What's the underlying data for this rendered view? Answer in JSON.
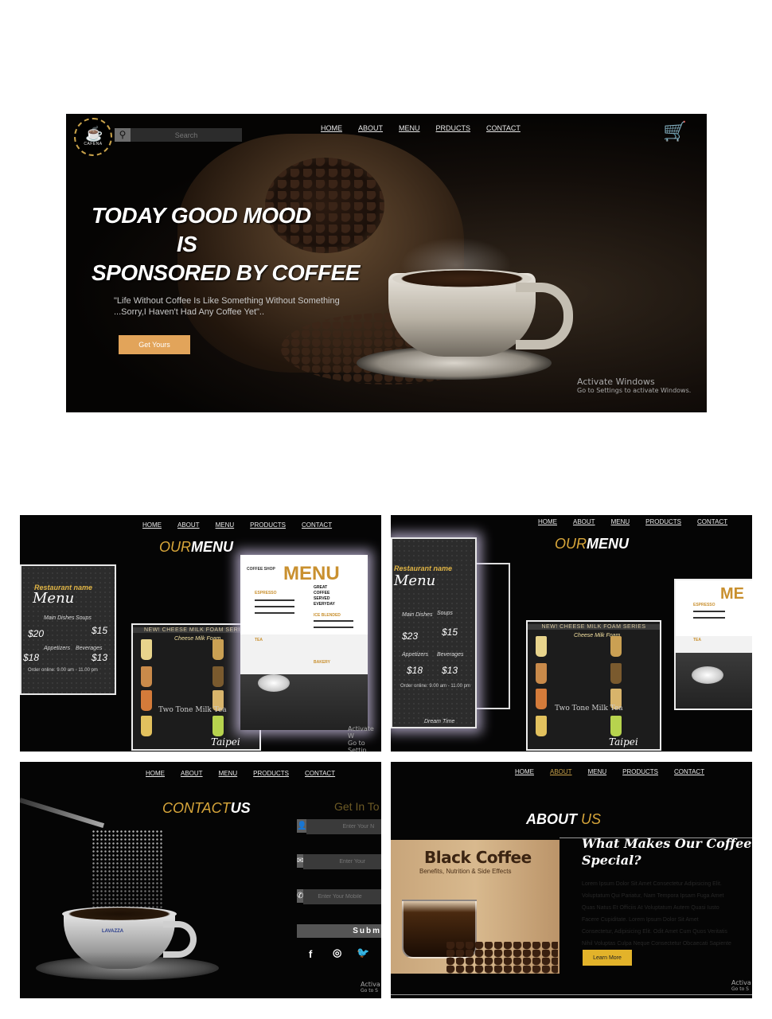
{
  "hero": {
    "nav": [
      "HOME",
      "ABOUT",
      "MENU",
      "PRDUCTS",
      "CONTACT"
    ],
    "logo_text": "CAFENA",
    "search_placeholder": "Search",
    "headline": [
      "TODAY GOOD MOOD",
      "IS",
      "SPONSORED BY COFFEE"
    ],
    "quote": [
      "\"Life Without Coffee Is Like Something Without Something",
      "...Sorry,I Haven't Had Any Coffee Yet\".."
    ],
    "cta": "Get Yours",
    "watermark": [
      "Activate Windows",
      "Go to Settings to activate Windows."
    ],
    "icons": {
      "search": "search-icon",
      "cart": "cart-icon"
    }
  },
  "menu_left": {
    "nav": [
      "HOME",
      "ABOUT",
      "MENU",
      "PRODUCTS",
      "CONTACT"
    ],
    "title": [
      "OUR",
      "MENU"
    ],
    "chalk": {
      "restaurant": "Restaurant name",
      "menu": "Menu",
      "prices": [
        "$20",
        "$15",
        "$18",
        "$13"
      ],
      "items": [
        "Main Dishes",
        "Soups",
        "Appetizers",
        "Beverages"
      ],
      "footer": "Order online: 9.00 am - 11.00 pm"
    },
    "milk": {
      "header": "NEW! CHEESE MILK FOAM SERIES",
      "label": "Cheese Milk Foam",
      "two": "Two Tone Milk Tea",
      "taipei": "Taipei"
    },
    "card": {
      "brand": "COFFEE SHOP",
      "heading": "MENU",
      "sections": [
        "ESPRESSO",
        "TEA",
        "ICE BLENDED",
        "BAKERY"
      ],
      "tagline": [
        "GREAT",
        "COFFEE",
        "SERVED",
        "EVERYDAY"
      ]
    },
    "watermark": [
      "Activate W",
      "Go to Settin"
    ]
  },
  "menu_right": {
    "nav": [
      "HOME",
      "ABOUT",
      "MENU",
      "PRODUCTS",
      "CONTACT"
    ],
    "title": [
      "OUR",
      "MENU"
    ],
    "chalk": {
      "restaurant": "Restaurant name",
      "menu": "Menu",
      "prices": [
        "$23",
        "$15",
        "$18",
        "$13"
      ],
      "items": [
        "Main Dishes",
        "Soups",
        "Appetizers",
        "Beverages"
      ],
      "footer": "Order online: 9.00 am - 11.00 pm",
      "dream": "Dream Time"
    },
    "milk": {
      "header": "NEW! CHEESE MILK FOAM SERIES",
      "label": "Cheese Milk Foam",
      "two": "Two Tone Milk Tea",
      "taipei": "Taipei"
    },
    "card": {
      "heading": "ME",
      "sections": [
        "ESPRESSO",
        "TEA"
      ]
    }
  },
  "contact": {
    "nav": [
      "HOME",
      "ABOUT",
      "MENU",
      "PRODUCTS",
      "CONTACT"
    ],
    "title": [
      "CONTACT",
      "US"
    ],
    "get_in": "Get In To",
    "fields": [
      "Enter Your N",
      "Enter Your",
      "Enter Your Mobile"
    ],
    "submit": "Subm",
    "brand": "LAVAZZA",
    "watermark": [
      "Activa",
      "Go to S"
    ],
    "icons": {
      "name": "user-icon",
      "email": "envelope-icon",
      "phone": "phone-icon",
      "facebook": "facebook-icon",
      "instagram": "instagram-icon",
      "twitter": "twitter-icon"
    }
  },
  "about": {
    "nav": [
      "HOME",
      "ABOUT",
      "MENU",
      "PRODUCTS",
      "CONTACT"
    ],
    "title": [
      "ABOUT",
      "US"
    ],
    "image_title": "Black Coffee",
    "image_sub": "Benefits, Nutrition & Side Effects",
    "heading": [
      "What Makes Our Coffee",
      "Special?"
    ],
    "lorem": [
      "Lorem Ipsum Dolor Sit Amet Consectetur Adipisicing Elit.",
      "Voluptatum Qui Pariatur, Nam Tempora Ipsam Fuga Amet",
      "Quas Natus Et Officiis At Voluptatum Autem Quasi Iusto",
      "Facere Cupiditate. Lorem Ipsum Dolor Sit Amet",
      "Consectetur, Adipisicing Elit. Odit Amet Cum Quos Veritatis",
      "Nihil Voluptas Culpa Neque Consectetur Obcaecati Sapiente"
    ],
    "learn": "Learn More",
    "watermark": [
      "Activa",
      "Go to S"
    ]
  },
  "colors": {
    "accent": "#d8a63a",
    "cta": "#e2a45a",
    "learn": "#e3b32a"
  }
}
